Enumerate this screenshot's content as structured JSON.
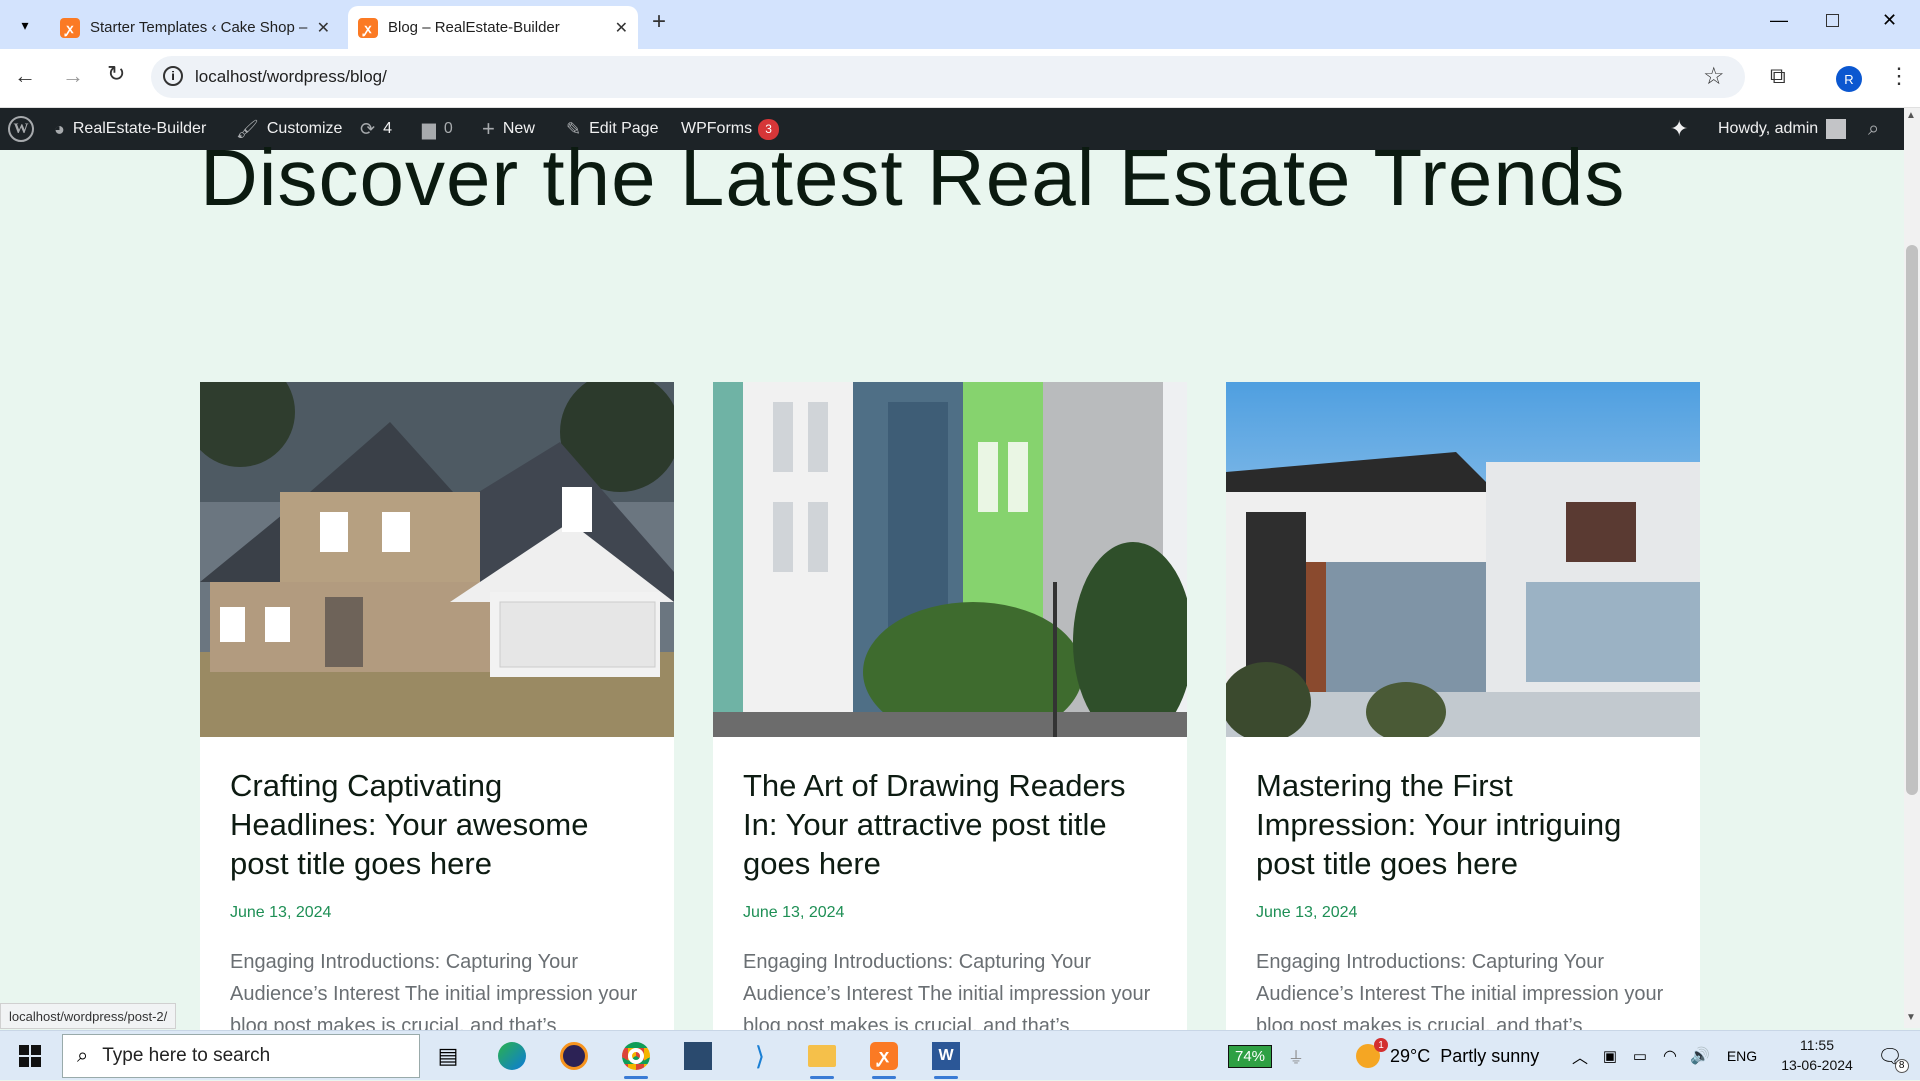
{
  "browser": {
    "tabs": [
      {
        "title": "Starter Templates ‹ Cake Shop –",
        "favicon": "xampp-icon"
      },
      {
        "title": "Blog – RealEstate-Builder",
        "favicon": "xampp-icon"
      }
    ],
    "url": "localhost/wordpress/blog/",
    "profile_initial": "R"
  },
  "admin_bar": {
    "site_name": "RealEstate-Builder",
    "customize": "Customize",
    "updates_count": "4",
    "comments_count": "0",
    "new": "New",
    "edit_page": "Edit Page",
    "wpforms": "WPForms",
    "wpforms_badge": "3",
    "howdy": "Howdy, admin"
  },
  "page": {
    "heading": "Discover the Latest Real Estate Trends",
    "posts": [
      {
        "title": "Crafting Captivating Headlines: Your awesome post title goes here",
        "date": "June 13, 2024",
        "excerpt": "Engaging Introductions: Capturing Your Audience’s Interest The initial impression your blog post makes is crucial, and that’s"
      },
      {
        "title": "The Art of Drawing Readers In: Your attractive post title goes here",
        "date": "June 13, 2024",
        "excerpt": "Engaging Introductions: Capturing Your Audience’s Interest The initial impression your blog post makes is crucial, and that’s"
      },
      {
        "title": "Mastering the First Impression: Your intriguing post title goes here",
        "date": "June 13, 2024",
        "excerpt": "Engaging Introductions: Capturing Your Audience’s Interest The initial impression your blog post makes is crucial, and that’s"
      }
    ]
  },
  "status_url": "localhost/wordpress/post-2/",
  "taskbar": {
    "search_placeholder": "Type here to search",
    "battery": "74%",
    "weather_temp": "29°C",
    "weather_text": "Partly sunny",
    "weather_badge": "1",
    "language": "ENG",
    "time": "11:55",
    "date": "13-06-2024",
    "notification_count": "8"
  },
  "colors": {
    "accent_date": "#1e8f55",
    "admin_bar": "#1d2327",
    "page_bg": "#e9f6ef"
  }
}
